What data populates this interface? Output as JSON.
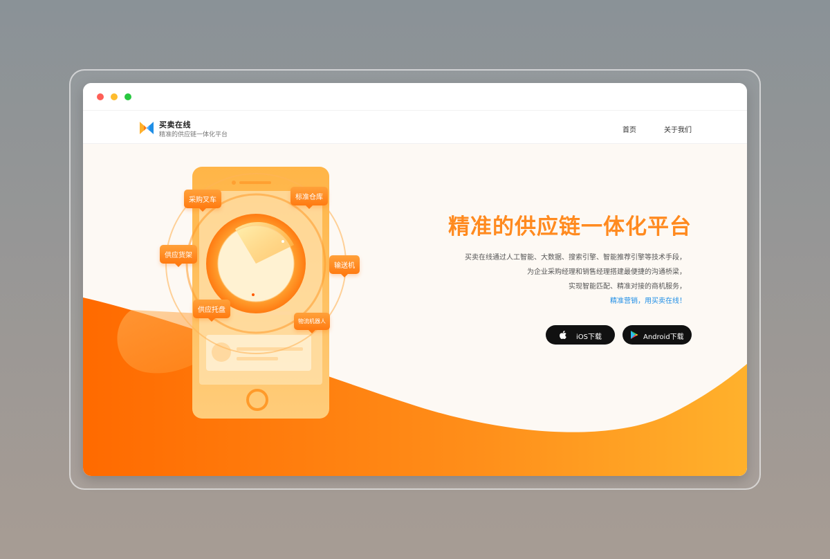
{
  "app": {
    "name": "买卖在线",
    "slogan": "精准的供应链一体化平台"
  },
  "nav": {
    "home": "首页",
    "about": "关于我们"
  },
  "hero": {
    "headline": "精准的供应链一体化平台",
    "description_lines": [
      "买卖在线通过人工智能、大数据、搜索引擎、智能推荐引擎等技术手段，",
      "为企业采购经理和销售经理搭建最便捷的沟通桥梁，",
      "实现智能匹配、精准对接的商机服务，",
      "精准营销，用买卖在线！"
    ],
    "download": {
      "ios_label": "iOS下载",
      "android_label": "Android下载"
    }
  },
  "illustration_tags": {
    "purchase_forklift": "采购叉车",
    "standard_warehouse": "标准仓库",
    "supply_shelf": "供应货架",
    "conveyor": "输送机",
    "supply_pallet": "供应托盘",
    "logistics_robot": "物流机器人"
  },
  "colors": {
    "accent": "#ff8a1f",
    "link_blue": "#1f8ee6",
    "button_dark": "#111111",
    "wave_start": "#ff6a00",
    "wave_end": "#ffb12c"
  },
  "icons": {
    "logo": "app-logo-icon",
    "ios": "apple-icon",
    "android": "google-play-icon"
  }
}
